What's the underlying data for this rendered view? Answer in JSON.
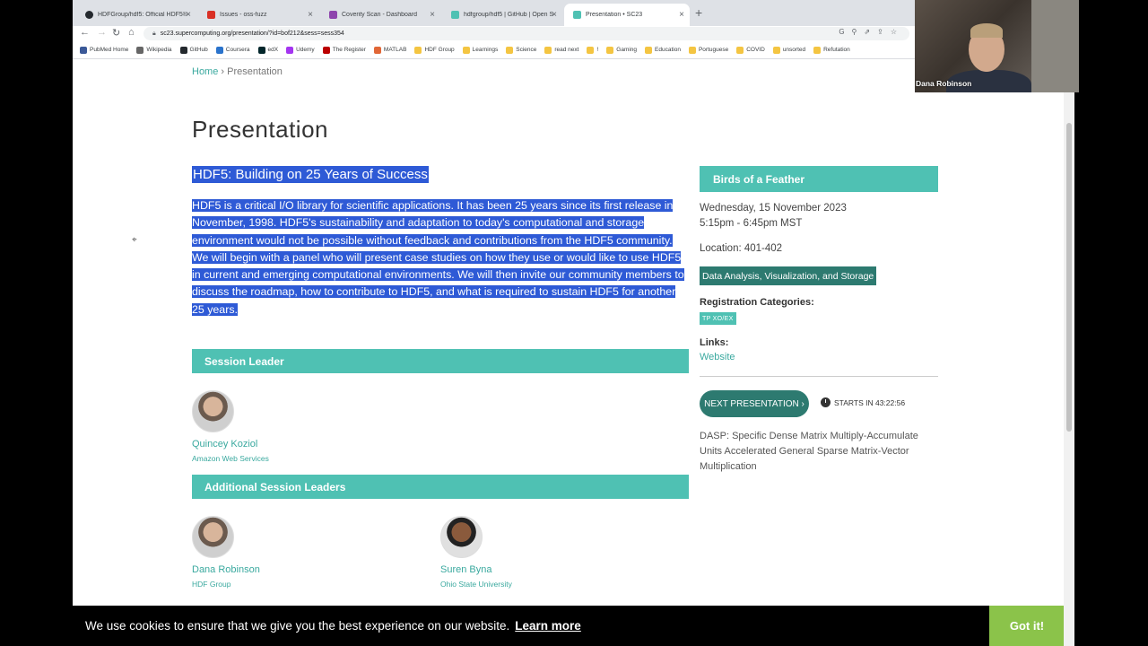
{
  "browser": {
    "tabs": [
      {
        "title": "HDFGroup/hdf5: Official HDF5®",
        "favicon_color": "#24292e"
      },
      {
        "title": "Issues - oss-fuzz",
        "favicon_color": "#d93025"
      },
      {
        "title": "Coverity Scan - Dashboard",
        "favicon_color": "#8e44ad"
      },
      {
        "title": "hdfgroup/hdf5 | GitHub | Open S",
        "favicon_color": "#4fc1b3"
      },
      {
        "title": "Presentation • SC23",
        "favicon_color": "#4fc1b3",
        "active": true
      }
    ],
    "new_tab": "+",
    "url": "sc23.supercomputing.org/presentation/?id=bof212&sess=sess354",
    "bookmarks": [
      {
        "label": "PubMed Home",
        "icon": "page-icon",
        "color": "#3b5998"
      },
      {
        "label": "Wikipedia",
        "icon": "wikipedia-icon",
        "color": "#666"
      },
      {
        "label": "GitHub",
        "icon": "github-icon",
        "color": "#24292e"
      },
      {
        "label": "Coursera",
        "icon": "coursera-icon",
        "color": "#2a73cc"
      },
      {
        "label": "edX",
        "icon": "edx-icon",
        "color": "#02262b"
      },
      {
        "label": "Udemy",
        "icon": "udemy-icon",
        "color": "#a435f0"
      },
      {
        "label": "The Register",
        "icon": "register-icon",
        "color": "#b00"
      },
      {
        "label": "MATLAB",
        "icon": "matlab-icon",
        "color": "#e16737"
      },
      {
        "label": "HDF Group",
        "icon": "folder-icon",
        "color": "#f4c542"
      },
      {
        "label": "Learnings",
        "icon": "folder-icon",
        "color": "#f4c542"
      },
      {
        "label": "Science",
        "icon": "folder-icon",
        "color": "#f4c542"
      },
      {
        "label": "read next",
        "icon": "folder-icon",
        "color": "#f4c542"
      },
      {
        "label": "!",
        "icon": "folder-icon",
        "color": "#f4c542"
      },
      {
        "label": "Gaming",
        "icon": "folder-icon",
        "color": "#f4c542"
      },
      {
        "label": "Education",
        "icon": "folder-icon",
        "color": "#f4c542"
      },
      {
        "label": "Portuguese",
        "icon": "folder-icon",
        "color": "#f4c542"
      },
      {
        "label": "COVID",
        "icon": "folder-icon",
        "color": "#f4c542"
      },
      {
        "label": "unsorted",
        "icon": "folder-icon",
        "color": "#f4c542"
      },
      {
        "label": "Refutation",
        "icon": "folder-icon",
        "color": "#f4c542"
      }
    ]
  },
  "breadcrumb": {
    "home": "Home",
    "separator": "›",
    "current": "Presentation"
  },
  "page_title": "Presentation",
  "session": {
    "title": "HDF5: Building on 25 Years of Success",
    "abstract": "HDF5 is a critical I/O library for scientific applications. It has been 25 years since its first release in November, 1998. HDF5's sustainability and adaptation to today's computational and storage environment would not be possible without feedback and contributions from the HDF5 community. We will begin with a panel who will present case studies on how they use or would like to use HDF5 in current and emerging computational environments. We will then invite our community members to discuss the roadmap, how to contribute to HDF5, and what is required to sustain HDF5 for another 25 years."
  },
  "session_leader": {
    "heading": "Session Leader",
    "people": [
      {
        "name": "Quincey Koziol",
        "org": "Amazon Web Services"
      }
    ]
  },
  "additional_leaders": {
    "heading": "Additional Session Leaders",
    "people": [
      {
        "name": "Dana Robinson",
        "org": "HDF Group"
      },
      {
        "name": "Suren Byna",
        "org": "Ohio State University"
      }
    ]
  },
  "sidebar": {
    "type": "Birds of a Feather",
    "date": "Wednesday, 15 November 2023",
    "time": "5:15pm - 6:45pm MST",
    "location": "Location: 401-402",
    "track_tag": "Data Analysis, Visualization, and Storage",
    "registration_label": "Registration Categories:",
    "registration_badge": "TP  XO/EX",
    "links_label": "Links:",
    "website": "Website",
    "next_button": "NEXT PRESENTATION ›",
    "starts_in": "STARTS IN 43:22:56",
    "next_title": "DASP: Specific Dense Matrix Multiply-Accumulate Units Accelerated General Sparse Matrix-Vector Multiplication"
  },
  "cookie": {
    "message": "We use cookies to ensure that we give you the best experience on our website.",
    "learn_more": "Learn more",
    "accept": "Got it!"
  },
  "webcam": {
    "name": "Dana Robinson"
  }
}
